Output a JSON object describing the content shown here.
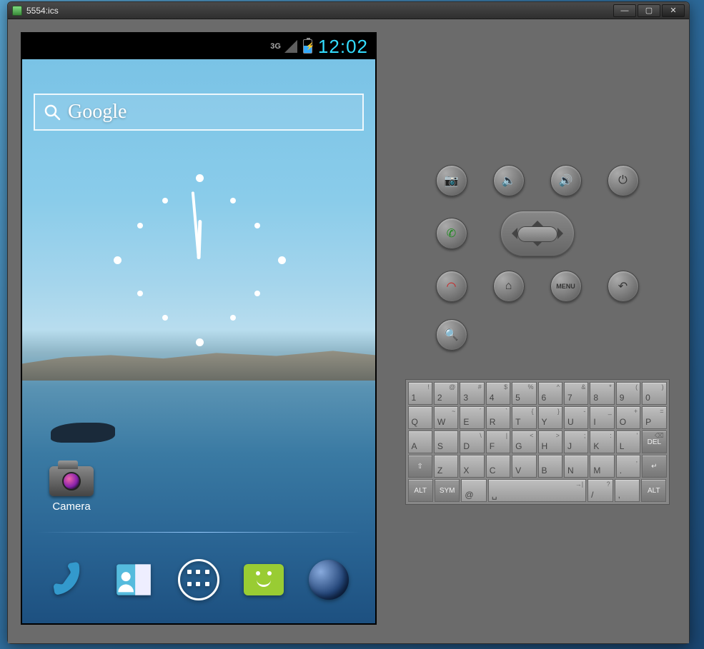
{
  "window": {
    "title": "5554:ics"
  },
  "statusbar": {
    "network": "3G",
    "time": "12:02"
  },
  "search": {
    "brand": "Google"
  },
  "homescreen": {
    "app_label": "Camera",
    "dock": [
      "phone",
      "contacts",
      "apps",
      "messaging",
      "browser"
    ]
  },
  "hw_buttons": {
    "row1": [
      "camera",
      "vol-down",
      "vol-up",
      "power"
    ],
    "row2": [
      "call",
      "dpad",
      "",
      "hangup"
    ],
    "row3": [
      "home",
      "menu",
      "back",
      "search"
    ],
    "menu_label": "MENU"
  },
  "keyboard": {
    "row1": [
      {
        "k": "1",
        "s": "!"
      },
      {
        "k": "2",
        "s": "@"
      },
      {
        "k": "3",
        "s": "#"
      },
      {
        "k": "4",
        "s": "$"
      },
      {
        "k": "5",
        "s": "%"
      },
      {
        "k": "6",
        "s": "^"
      },
      {
        "k": "7",
        "s": "&"
      },
      {
        "k": "8",
        "s": "*"
      },
      {
        "k": "9",
        "s": "("
      },
      {
        "k": "0",
        "s": ")"
      }
    ],
    "row2": [
      {
        "k": "Q"
      },
      {
        "k": "W",
        "s": "~"
      },
      {
        "k": "E",
        "s": "´"
      },
      {
        "k": "R",
        "s": "`"
      },
      {
        "k": "T",
        "s": "{"
      },
      {
        "k": "Y",
        "s": "}"
      },
      {
        "k": "U",
        "s": "-"
      },
      {
        "k": "I",
        "s": "_"
      },
      {
        "k": "O",
        "s": "+"
      },
      {
        "k": "P",
        "s": "="
      }
    ],
    "row3": [
      {
        "k": "A"
      },
      {
        "k": "S"
      },
      {
        "k": "D",
        "s": "\\"
      },
      {
        "k": "F",
        "s": "|"
      },
      {
        "k": "G",
        "s": "<"
      },
      {
        "k": "H",
        "s": ">"
      },
      {
        "k": "J",
        "s": ";"
      },
      {
        "k": "K",
        "s": ":"
      },
      {
        "k": "L",
        "s": "'"
      },
      {
        "k": "DEL",
        "mod": true,
        "s": "⌫"
      }
    ],
    "row4": [
      {
        "k": "⇧",
        "mod": true
      },
      {
        "k": "Z"
      },
      {
        "k": "X"
      },
      {
        "k": "C"
      },
      {
        "k": "V"
      },
      {
        "k": "B"
      },
      {
        "k": "N"
      },
      {
        "k": "M"
      },
      {
        "k": ".",
        "s": ","
      },
      {
        "k": "↵",
        "mod": true
      }
    ],
    "row5": [
      {
        "k": "ALT",
        "mod": true
      },
      {
        "k": "SYM",
        "mod": true
      },
      {
        "k": "@"
      },
      {
        "k": "␣",
        "wide": 5,
        "s": "→|"
      },
      {
        "k": "/",
        "s": "?"
      },
      {
        "k": ",",
        "s": ""
      },
      {
        "k": "ALT",
        "mod": true
      }
    ]
  }
}
